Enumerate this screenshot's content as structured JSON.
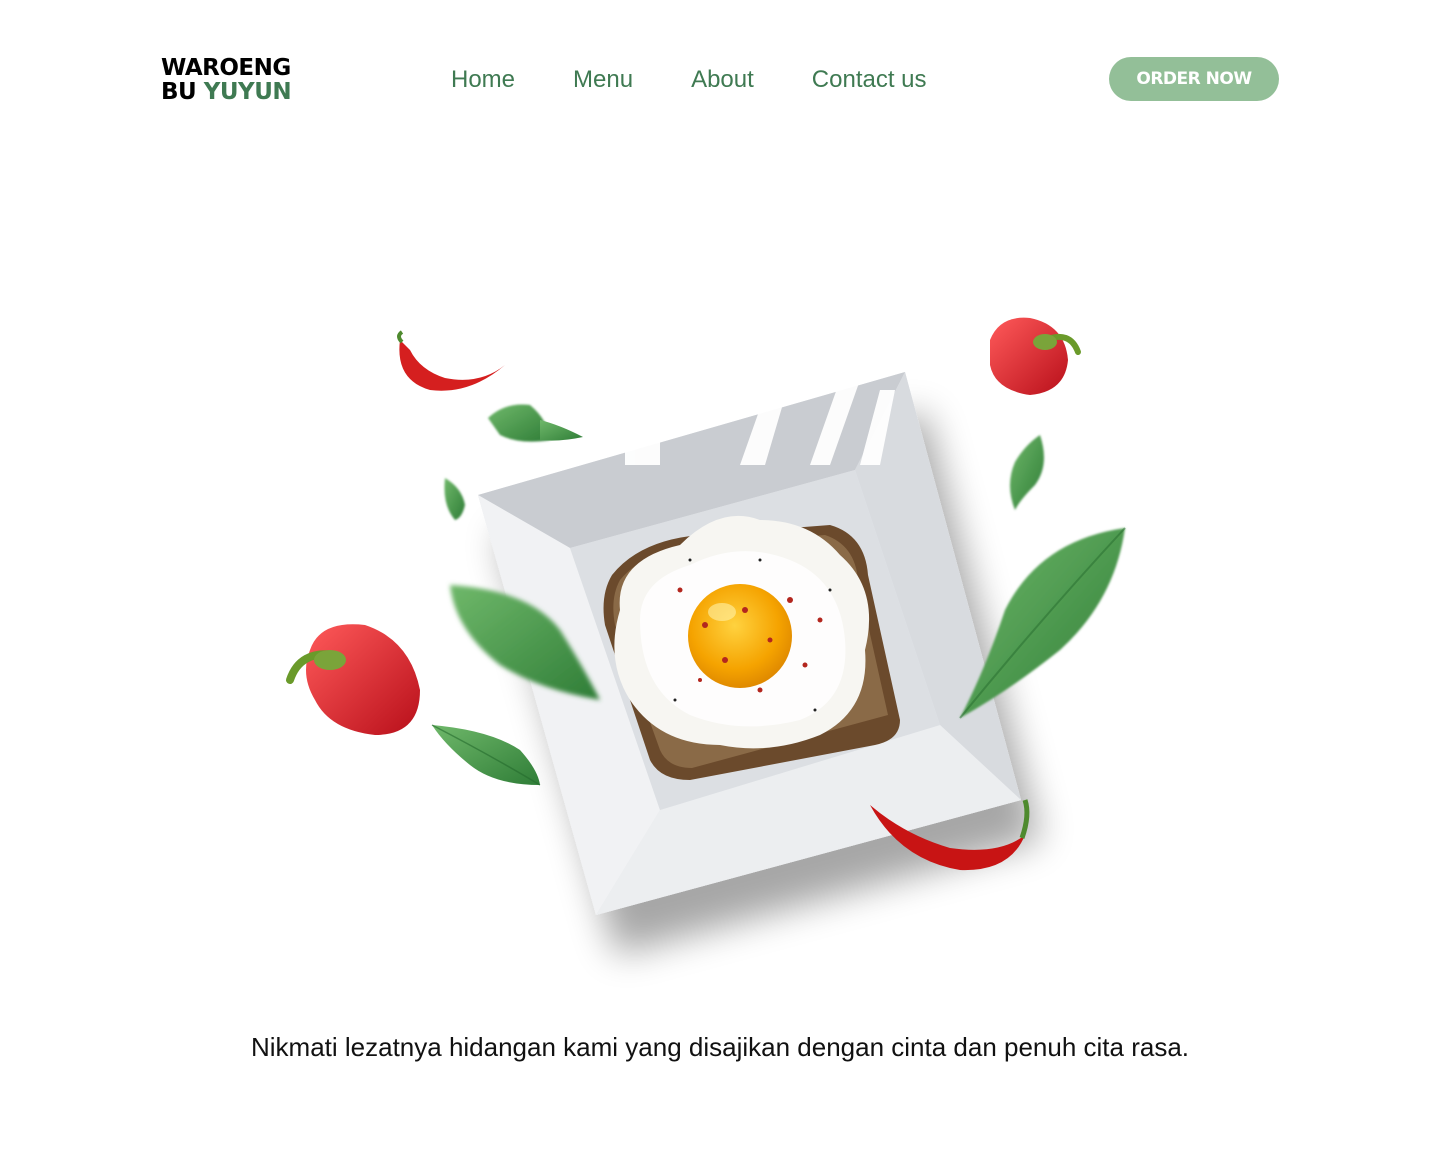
{
  "brand": {
    "line1": "WAROENG",
    "line2_prefix": "BU ",
    "line2_accent": "YUYUN",
    "accent_color": "#3f7a52"
  },
  "nav": {
    "items": [
      {
        "label": "Home"
      },
      {
        "label": "Menu"
      },
      {
        "label": "About"
      },
      {
        "label": "Contact us"
      }
    ]
  },
  "cta": {
    "label": "ORDER NOW",
    "color": "#93bf98"
  },
  "hero": {
    "tagline": "Nikmati lezatnya hidangan kami yang disajikan dengan cinta dan penuh cita rasa.",
    "image": {
      "plate": "square-white-plate",
      "food": "egg-toast-icon",
      "garnish": [
        "chili-pepper-icon",
        "bell-pepper-icon",
        "basil-leaf-icon"
      ]
    }
  }
}
